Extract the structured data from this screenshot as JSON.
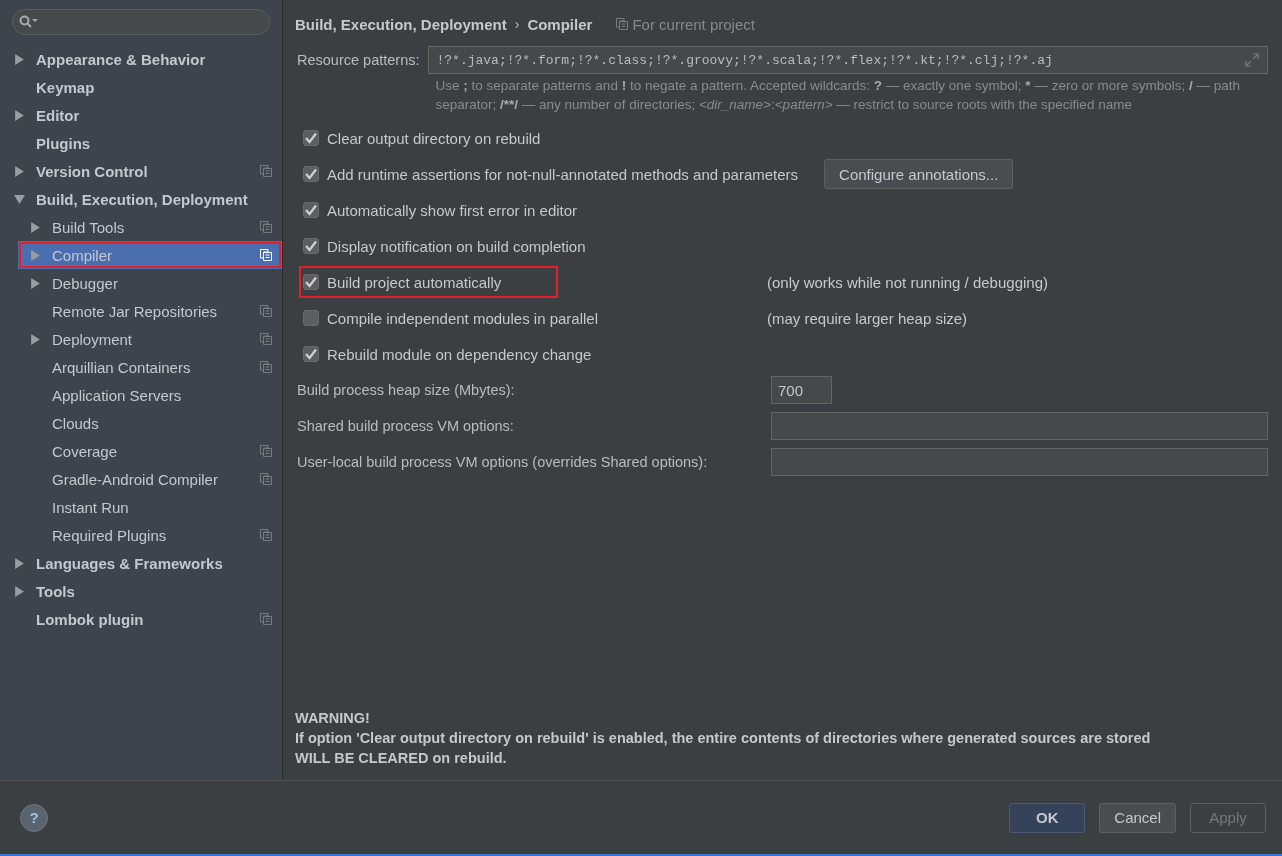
{
  "sidebar": {
    "items": [
      {
        "label": "Appearance & Behavior",
        "expanded": false,
        "project_scope": false,
        "selected": false,
        "highlighted": false
      },
      {
        "label": "Keymap",
        "project_scope": false,
        "selected": false,
        "highlighted": false
      },
      {
        "label": "Editor",
        "expanded": false,
        "project_scope": false,
        "selected": false,
        "highlighted": false
      },
      {
        "label": "Plugins",
        "project_scope": false,
        "selected": false,
        "highlighted": false
      },
      {
        "label": "Version Control",
        "expanded": false,
        "project_scope": true,
        "selected": false,
        "highlighted": false
      },
      {
        "label": "Build, Execution, Deployment",
        "expanded": true,
        "project_scope": false,
        "selected": false,
        "highlighted": false,
        "children": [
          {
            "label": "Build Tools",
            "expanded": false,
            "project_scope": true,
            "selected": false,
            "highlighted": false
          },
          {
            "label": "Compiler",
            "expanded": false,
            "project_scope": true,
            "selected": true,
            "highlighted": true
          },
          {
            "label": "Debugger",
            "expanded": false,
            "project_scope": false,
            "selected": false,
            "highlighted": false
          },
          {
            "label": "Remote Jar Repositories",
            "project_scope": true,
            "selected": false,
            "highlighted": false
          },
          {
            "label": "Deployment",
            "expanded": false,
            "project_scope": true,
            "selected": false,
            "highlighted": false
          },
          {
            "label": "Arquillian Containers",
            "project_scope": true,
            "selected": false,
            "highlighted": false
          },
          {
            "label": "Application Servers",
            "project_scope": false,
            "selected": false,
            "highlighted": false
          },
          {
            "label": "Clouds",
            "project_scope": false,
            "selected": false,
            "highlighted": false
          },
          {
            "label": "Coverage",
            "project_scope": true,
            "selected": false,
            "highlighted": false
          },
          {
            "label": "Gradle-Android Compiler",
            "project_scope": true,
            "selected": false,
            "highlighted": false
          },
          {
            "label": "Instant Run",
            "project_scope": false,
            "selected": false,
            "highlighted": false
          },
          {
            "label": "Required Plugins",
            "project_scope": true,
            "selected": false,
            "highlighted": false
          }
        ]
      },
      {
        "label": "Languages & Frameworks",
        "expanded": false,
        "project_scope": false,
        "selected": false,
        "highlighted": false
      },
      {
        "label": "Tools",
        "expanded": false,
        "project_scope": false,
        "selected": false,
        "highlighted": false
      },
      {
        "label": "Lombok plugin",
        "project_scope": true,
        "selected": false,
        "highlighted": false
      }
    ]
  },
  "breadcrumb": {
    "parent": "Build, Execution, Deployment",
    "separator": "›",
    "current": "Compiler",
    "scope": "For current project"
  },
  "resource_patterns": {
    "label": "Resource patterns:",
    "value": "!?*.java;!?*.form;!?*.class;!?*.groovy;!?*.scala;!?*.flex;!?*.kt;!?*.clj;!?*.aj",
    "hint": [
      {
        "text": "Use ",
        "kind": "plain"
      },
      {
        "text": ";",
        "kind": "bold"
      },
      {
        "text": " to separate patterns and ",
        "kind": "plain"
      },
      {
        "text": "!",
        "kind": "bold"
      },
      {
        "text": " to negate a pattern. Accepted wildcards: ",
        "kind": "plain"
      },
      {
        "text": "?",
        "kind": "bold"
      },
      {
        "text": " — exactly one symbol; ",
        "kind": "plain"
      },
      {
        "text": "*",
        "kind": "bold"
      },
      {
        "text": " — zero or more symbols; ",
        "kind": "plain"
      },
      {
        "text": "/",
        "kind": "bold"
      },
      {
        "text": " — path separator; ",
        "kind": "plain"
      },
      {
        "text": "/**/",
        "kind": "bold"
      },
      {
        "text": " — any number of directories; ",
        "kind": "plain"
      },
      {
        "text": "<dir_name>",
        "kind": "italic"
      },
      {
        "text": ":",
        "kind": "plain"
      },
      {
        "text": "<pattern>",
        "kind": "italic"
      },
      {
        "text": " — restrict to source roots with the specified name",
        "kind": "plain"
      }
    ]
  },
  "options": [
    {
      "label": "Clear output directory on rebuild",
      "checked": true,
      "highlighted": false
    },
    {
      "label": "Add runtime assertions for not-null-annotated methods and parameters",
      "checked": true,
      "highlighted": false,
      "button": "Configure annotations..."
    },
    {
      "label": "Automatically show first error in editor",
      "checked": true,
      "highlighted": false
    },
    {
      "label": "Display notification on build completion",
      "checked": true,
      "highlighted": false
    },
    {
      "label": "Build project automatically",
      "checked": true,
      "highlighted": true,
      "note": "(only works while not running / debugging)"
    },
    {
      "label": "Compile independent modules in parallel",
      "checked": false,
      "highlighted": false,
      "note": "(may require larger heap size)"
    },
    {
      "label": "Rebuild module on dependency change",
      "checked": true,
      "highlighted": false
    }
  ],
  "fields": [
    {
      "label": "Build process heap size (Mbytes):",
      "value": "700",
      "kind": "short"
    },
    {
      "label": "Shared build process VM options:",
      "kind": "wide"
    },
    {
      "label": "User-local build process VM options (overrides Shared options):",
      "kind": "wide"
    }
  ],
  "warning": {
    "title": "WARNING!",
    "lines": [
      "If option 'Clear output directory on rebuild' is enabled, the entire contents of directories where generated sources are stored",
      "WILL BE CLEARED on rebuild."
    ]
  },
  "footer": {
    "help": "?",
    "buttons": [
      {
        "label": "OK",
        "kind": "default",
        "disabled": false
      },
      {
        "label": "Cancel",
        "kind": "normal",
        "disabled": false
      },
      {
        "label": "Apply",
        "kind": "normal",
        "disabled": true
      }
    ]
  }
}
